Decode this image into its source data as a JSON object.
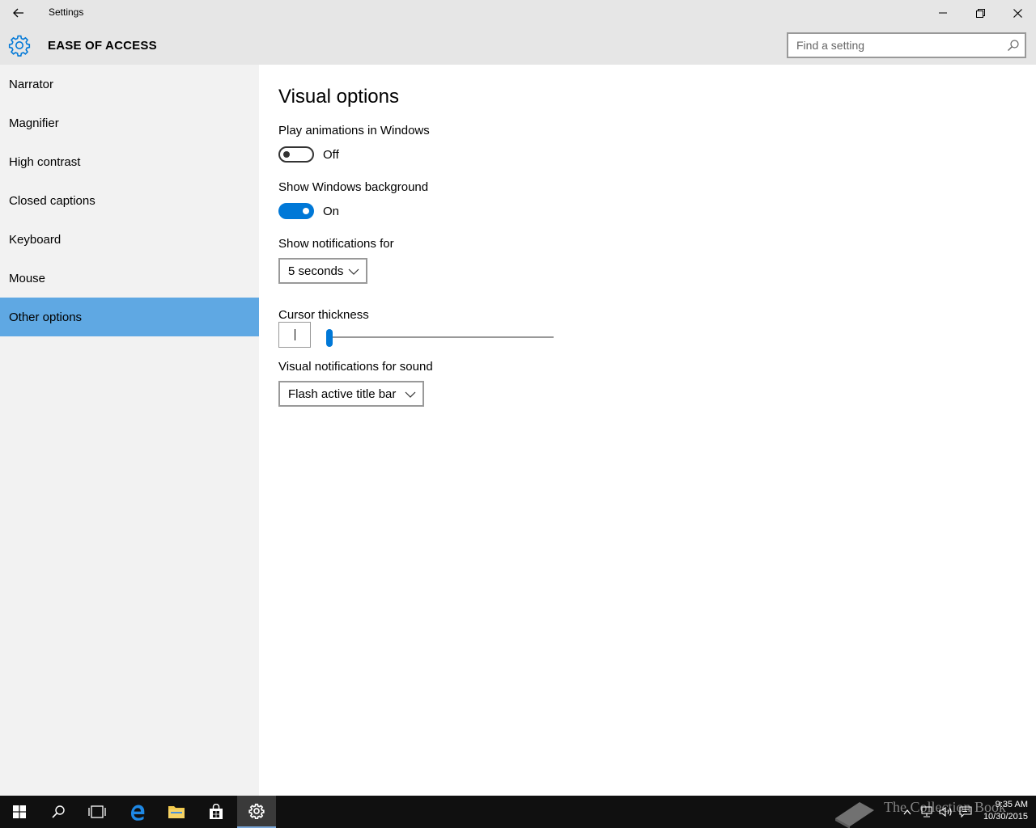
{
  "window": {
    "title": "Settings",
    "back_icon": "back-arrow-icon",
    "minimize_icon": "minimize-icon",
    "restore_icon": "restore-icon",
    "close_icon": "close-icon"
  },
  "header": {
    "icon": "gear-icon",
    "title": "EASE OF ACCESS",
    "search_placeholder": "Find a setting",
    "search_icon": "search-icon"
  },
  "sidebar": {
    "items": [
      {
        "label": "Narrator",
        "selected": false
      },
      {
        "label": "Magnifier",
        "selected": false
      },
      {
        "label": "High contrast",
        "selected": false
      },
      {
        "label": "Closed captions",
        "selected": false
      },
      {
        "label": "Keyboard",
        "selected": false
      },
      {
        "label": "Mouse",
        "selected": false
      },
      {
        "label": "Other options",
        "selected": true
      }
    ],
    "selected_color": "#5fa8e3"
  },
  "main": {
    "heading": "Visual options",
    "animations": {
      "label": "Play animations in Windows",
      "state": "Off",
      "on": false
    },
    "background": {
      "label": "Show Windows background",
      "state": "On",
      "on": true
    },
    "notifications": {
      "label": "Show notifications for",
      "value": "5 seconds"
    },
    "cursor": {
      "label": "Cursor thickness",
      "value_fraction": 0.0
    },
    "sound": {
      "label": "Visual notifications for sound",
      "value": "Flash active title bar"
    },
    "accent_color": "#0078d7"
  },
  "taskbar": {
    "items": [
      "windows-start-icon",
      "search-icon",
      "task-view-icon",
      "edge-icon",
      "file-explorer-icon",
      "store-icon",
      "settings-icon"
    ],
    "active_item": "settings-icon",
    "tray_icons": [
      "chevron-up-icon",
      "network-icon",
      "volume-icon",
      "action-center-icon"
    ],
    "time": "9:35 AM",
    "date": "10/30/2015",
    "watermark": "The Collection Book"
  }
}
